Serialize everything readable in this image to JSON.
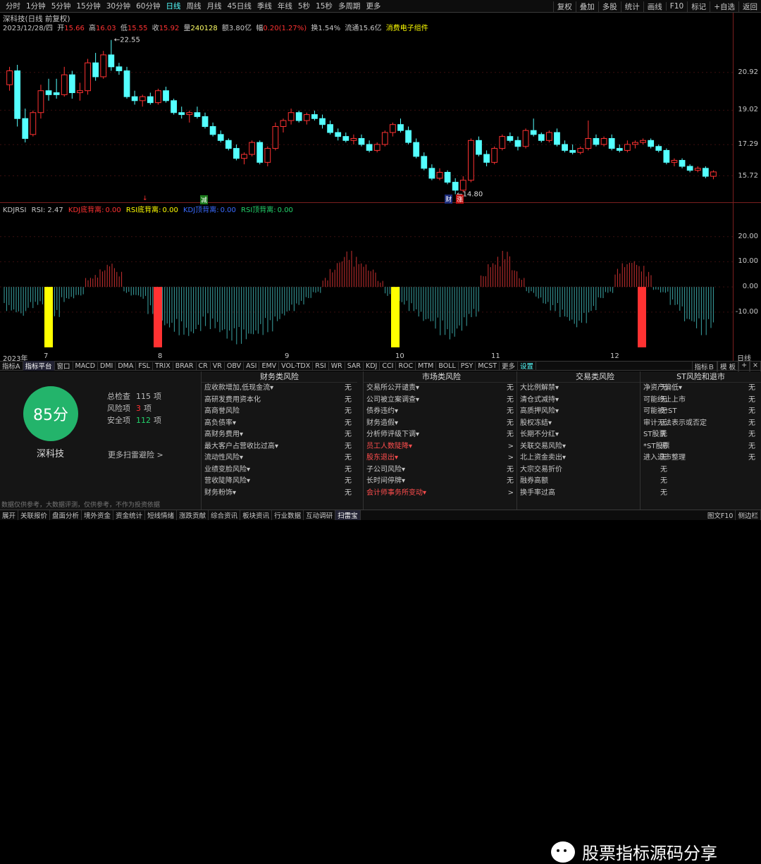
{
  "top_tabs": [
    "分时",
    "1分钟",
    "5分钟",
    "15分钟",
    "30分钟",
    "60分钟",
    "日线",
    "周线",
    "月线",
    "45日线",
    "季线",
    "年线",
    "5秒",
    "15秒",
    "多周期",
    "更多"
  ],
  "top_right": [
    "复权",
    "叠加",
    "多股",
    "统计",
    "画线",
    "F10",
    "标记",
    "+自选",
    "返回"
  ],
  "stock_title": "深科技(日线 前复权)",
  "info": {
    "date": "2023/12/28/四",
    "open_label": "开",
    "open": "15.66",
    "high_label": "高",
    "high": "16.03",
    "low_label": "低",
    "low": "15.55",
    "close_label": "收",
    "close": "15.92",
    "vol_label": "量",
    "vol": "240128",
    "amt_label": "额",
    "amt": "3.80亿",
    "chg_label": "幅",
    "chg": "0.20(1.27%)",
    "turn_label": "换",
    "turn": "1.54%",
    "float_label": "流通",
    "float": "15.6亿",
    "concept": "消费电子组件"
  },
  "price_axis": [
    "20.92",
    "19.02",
    "17.29",
    "15.72"
  ],
  "hi_label": "22.55",
  "lo_label": "14.80",
  "flag_cai": "财",
  "flag_zhang": "涨",
  "mark_jian": "减",
  "mark_qu": "↓",
  "ind": {
    "name": "KDJRSI",
    "rsi_label": "RSI: 2.47",
    "kdj_di_label": "KDJ底背离:",
    "kdj_di": "0.00",
    "rsi_di_label": "RSI底背离:",
    "rsi_di": "0.00",
    "kdj_ding_label": "KDJ顶背离:",
    "kdj_ding": "0.00",
    "rsi_ding_label": "RSI顶背离:",
    "rsi_ding": "0.00"
  },
  "ind_axis": [
    "20.00",
    "10.00",
    "0.00",
    "-10.00"
  ],
  "dates": [
    "2023年",
    "7",
    "8",
    "9",
    "10",
    "11",
    "12",
    "日线"
  ],
  "tabs": [
    "指标A",
    "指标平台",
    "窗口",
    "MACD",
    "DMI",
    "DMA",
    "FSL",
    "TRIX",
    "BRAR",
    "CR",
    "VR",
    "OBV",
    "ASI",
    "EMV",
    "VOL-TDX",
    "RSI",
    "WR",
    "SAR",
    "KDJ",
    "CCI",
    "ROC",
    "MTM",
    "BOLL",
    "PSY",
    "MCST",
    "更多",
    "设置"
  ],
  "tabs_right": [
    "指标Ｂ",
    "模 板",
    "+",
    "×"
  ],
  "score": "85分",
  "name": "深科技",
  "stats": [
    {
      "label": "总检查",
      "value": "115",
      "unit": "项"
    },
    {
      "label": "风险项",
      "value": "3",
      "unit": "项"
    },
    {
      "label": "安全项",
      "value": "112",
      "unit": "项"
    }
  ],
  "more_link": "更多扫雷避险 >",
  "disclaimer": "数据仅供参考，大数据评测，仅供参考，不作为投资依据",
  "cols": [
    {
      "title": "财务类风险",
      "rows": [
        [
          "应收款增加,低现金流▾",
          "无"
        ],
        [
          "高研发费用资本化",
          "无"
        ],
        [
          "高商誉风险",
          "无"
        ],
        [
          "高负债率▾",
          "无"
        ],
        [
          "高财务费用▾",
          "无"
        ],
        [
          "最大客户占营收比过高▾",
          "无"
        ],
        [
          "流动性风险▾",
          "无"
        ],
        [
          "业绩变脸风险▾",
          "无"
        ],
        [
          "营收陡降风险▾",
          "无"
        ],
        [
          "财务粉饰▾",
          "无"
        ]
      ]
    },
    {
      "title": "市场类风险",
      "rows": [
        [
          "交易所公开谴责▾",
          "无"
        ],
        [
          "公司被立案调查▾",
          "无"
        ],
        [
          "债券违约▾",
          "无"
        ],
        [
          "财务造假▾",
          "无"
        ],
        [
          "分析师评级下调▾",
          "无"
        ],
        [
          "员工人数陡降▾",
          ">"
        ],
        [
          "股东退出▾",
          ">"
        ],
        [
          "子公司风险▾",
          "无"
        ],
        [
          "长时间停牌▾",
          "无"
        ],
        [
          "会计师事务所变动▾",
          ">"
        ]
      ]
    },
    {
      "title": "交易类风险",
      "rows": [
        [
          "大比例解禁▾",
          "无"
        ],
        [
          "清仓式减持▾",
          "无"
        ],
        [
          "高质押风险▾",
          "无"
        ],
        [
          "股权冻结▾",
          "无"
        ],
        [
          "长期不分红▾",
          "无"
        ],
        [
          "关联交易风险▾",
          "无"
        ],
        [
          "北上资金卖出▾",
          "无"
        ],
        [
          "大宗交易折价",
          "无"
        ],
        [
          "融券高额",
          "无"
        ],
        [
          "换手率过高",
          "无"
        ]
      ]
    },
    {
      "title": "ST风险和退市",
      "rows": [
        [
          "净资产偏低▾",
          "无"
        ],
        [
          "可能终止上市",
          "无"
        ],
        [
          "可能被*ST",
          "无"
        ],
        [
          "审计无法表示或否定",
          "无"
        ],
        [
          "ST股票",
          "无"
        ],
        [
          "*ST股票",
          "无"
        ],
        [
          "进入退市整理",
          "无"
        ]
      ]
    }
  ],
  "red_rows": {
    "1": [
      5,
      6,
      9
    ]
  },
  "watermark": "股票指标源码分享",
  "bottom_tabs": [
    "展开",
    "关联报价",
    "盘面分析",
    "境外资金",
    "资金统计",
    "短线情绪",
    "涨跌贡献",
    "综合资讯",
    "板块资讯",
    "行业数据",
    "互动调研",
    "扫雷宝"
  ],
  "bottom_right": [
    "图文F10",
    "侧边栏"
  ],
  "colors": {
    "up": "#ff3232",
    "down": "#54ffff",
    "yellow": "#ffff00",
    "green": "#23b46b"
  },
  "chart_data": {
    "type": "candlestick",
    "ohlc": [
      [
        20.3,
        21.2,
        20.0,
        21.0
      ],
      [
        21.0,
        21.3,
        18.2,
        18.6
      ],
      [
        18.6,
        19.1,
        17.4,
        17.6
      ],
      [
        17.8,
        19.0,
        17.7,
        18.9
      ],
      [
        18.9,
        20.3,
        18.6,
        20.0
      ],
      [
        20.0,
        20.6,
        19.5,
        19.8
      ],
      [
        19.9,
        20.6,
        19.6,
        19.8
      ],
      [
        19.8,
        21.2,
        19.7,
        20.8
      ],
      [
        20.8,
        21.0,
        19.6,
        19.9
      ],
      [
        19.9,
        20.4,
        19.5,
        20.0
      ],
      [
        20.0,
        21.6,
        19.8,
        21.4
      ],
      [
        21.4,
        21.9,
        20.5,
        20.7
      ],
      [
        20.7,
        22.0,
        20.6,
        21.8
      ],
      [
        21.8,
        22.55,
        21.0,
        21.2
      ],
      [
        21.2,
        21.4,
        20.8,
        21.0
      ],
      [
        21.0,
        21.2,
        19.6,
        19.7
      ],
      [
        19.7,
        20.0,
        19.3,
        19.5
      ],
      [
        19.5,
        19.8,
        19.2,
        19.7
      ],
      [
        19.7,
        19.9,
        19.3,
        19.4
      ],
      [
        19.4,
        20.1,
        19.3,
        20.0
      ],
      [
        20.0,
        20.2,
        19.4,
        19.5
      ],
      [
        19.5,
        19.6,
        18.8,
        18.9
      ],
      [
        18.9,
        19.2,
        18.6,
        18.8
      ],
      [
        18.8,
        19.0,
        18.4,
        18.9
      ],
      [
        18.9,
        19.2,
        18.6,
        18.7
      ],
      [
        18.7,
        18.9,
        18.1,
        18.2
      ],
      [
        18.2,
        18.4,
        17.7,
        17.8
      ],
      [
        17.8,
        18.0,
        17.4,
        17.5
      ],
      [
        17.5,
        17.6,
        17.0,
        17.1
      ],
      [
        17.1,
        17.3,
        16.5,
        16.6
      ],
      [
        16.6,
        16.9,
        16.3,
        16.8
      ],
      [
        16.8,
        17.5,
        16.7,
        17.4
      ],
      [
        17.4,
        17.5,
        16.3,
        16.4
      ],
      [
        16.4,
        17.2,
        16.2,
        17.1
      ],
      [
        17.1,
        18.4,
        17.0,
        18.2
      ],
      [
        18.2,
        18.6,
        17.9,
        18.5
      ],
      [
        18.5,
        19.1,
        18.3,
        18.9
      ],
      [
        18.9,
        19.0,
        18.4,
        18.5
      ],
      [
        18.5,
        18.9,
        18.3,
        18.8
      ],
      [
        18.8,
        19.0,
        18.5,
        18.6
      ],
      [
        18.6,
        18.8,
        18.1,
        18.3
      ],
      [
        18.3,
        18.5,
        17.8,
        17.9
      ],
      [
        17.9,
        18.1,
        17.5,
        17.7
      ],
      [
        17.7,
        17.9,
        17.4,
        17.5
      ],
      [
        17.5,
        17.8,
        17.3,
        17.6
      ],
      [
        17.6,
        17.8,
        17.2,
        17.3
      ],
      [
        17.3,
        17.5,
        16.9,
        17.0
      ],
      [
        17.0,
        17.4,
        16.9,
        17.3
      ],
      [
        17.3,
        18.0,
        17.2,
        17.9
      ],
      [
        17.9,
        18.4,
        17.7,
        18.3
      ],
      [
        18.3,
        18.6,
        17.9,
        18.0
      ],
      [
        18.0,
        18.2,
        17.3,
        17.4
      ],
      [
        17.4,
        17.6,
        16.6,
        16.7
      ],
      [
        16.7,
        16.9,
        16.0,
        16.1
      ],
      [
        16.1,
        16.3,
        15.5,
        15.6
      ],
      [
        15.6,
        16.1,
        15.5,
        15.9
      ],
      [
        15.9,
        16.0,
        15.3,
        15.4
      ],
      [
        15.4,
        15.6,
        14.8,
        15.0
      ],
      [
        15.0,
        15.7,
        14.9,
        15.5
      ],
      [
        15.5,
        17.6,
        15.4,
        17.5
      ],
      [
        17.5,
        17.7,
        16.7,
        16.8
      ],
      [
        16.8,
        17.0,
        16.2,
        16.4
      ],
      [
        16.4,
        17.2,
        16.3,
        17.1
      ],
      [
        17.1,
        17.8,
        17.0,
        17.7
      ],
      [
        17.7,
        17.9,
        17.4,
        17.5
      ],
      [
        17.5,
        17.7,
        17.0,
        17.2
      ],
      [
        17.2,
        18.1,
        17.1,
        18.0
      ],
      [
        18.0,
        18.6,
        17.7,
        17.8
      ],
      [
        17.8,
        17.9,
        17.4,
        17.5
      ],
      [
        17.5,
        18.0,
        17.4,
        17.9
      ],
      [
        17.9,
        18.1,
        17.2,
        17.3
      ],
      [
        17.3,
        17.5,
        16.9,
        17.0
      ],
      [
        17.0,
        17.3,
        16.8,
        16.9
      ],
      [
        16.9,
        17.2,
        16.8,
        17.1
      ],
      [
        17.1,
        18.5,
        17.0,
        17.6
      ],
      [
        17.6,
        17.8,
        17.2,
        17.3
      ],
      [
        17.3,
        17.7,
        17.2,
        17.6
      ],
      [
        17.6,
        17.8,
        17.0,
        17.1
      ],
      [
        17.1,
        17.3,
        16.9,
        17.0
      ],
      [
        17.0,
        17.5,
        16.9,
        17.3
      ],
      [
        17.3,
        17.5,
        17.1,
        17.4
      ],
      [
        17.4,
        17.6,
        17.3,
        17.5
      ],
      [
        17.5,
        17.6,
        17.1,
        17.2
      ],
      [
        17.2,
        17.3,
        16.9,
        17.0
      ],
      [
        17.0,
        17.1,
        16.3,
        16.4
      ],
      [
        16.4,
        16.6,
        16.2,
        16.5
      ],
      [
        16.5,
        16.6,
        16.1,
        16.2
      ],
      [
        16.2,
        16.3,
        15.9,
        16.0
      ],
      [
        16.0,
        16.2,
        15.9,
        16.1
      ],
      [
        16.1,
        16.2,
        15.6,
        15.7
      ],
      [
        15.7,
        16.0,
        15.55,
        15.92
      ]
    ],
    "kdjrsi": [
      -8,
      -9,
      -10,
      -7,
      -6,
      -8,
      -10,
      -5,
      -4,
      -3,
      3,
      4,
      6,
      8,
      5,
      -2,
      -3,
      -4,
      -9,
      -12,
      -14,
      -15,
      -16,
      -17,
      -15,
      -13,
      -14,
      -16,
      -18,
      -19,
      -18,
      -17,
      -16,
      -15,
      -12,
      -10,
      -8,
      -6,
      -4,
      -2,
      3,
      6,
      9,
      12,
      10,
      8,
      6,
      2,
      -3,
      -5,
      -6,
      -8,
      -10,
      -12,
      -14,
      -16,
      -18,
      -15,
      -13,
      -10,
      4,
      8,
      10,
      12,
      6,
      3,
      -2,
      -4,
      -6,
      -8,
      -10,
      -12,
      -14,
      -12,
      -8,
      -4,
      -2,
      6,
      8,
      9,
      7,
      5,
      -1,
      -2,
      -6,
      -8,
      -12,
      -14,
      -16,
      -14
    ],
    "signals": [
      {
        "i": 8,
        "color": "yellow"
      },
      {
        "i": 28,
        "color": "red"
      },
      {
        "i": 70,
        "color": "yellow"
      },
      {
        "i": 112,
        "color": "red"
      }
    ],
    "ylim": [
      14.5,
      23.0
    ]
  }
}
